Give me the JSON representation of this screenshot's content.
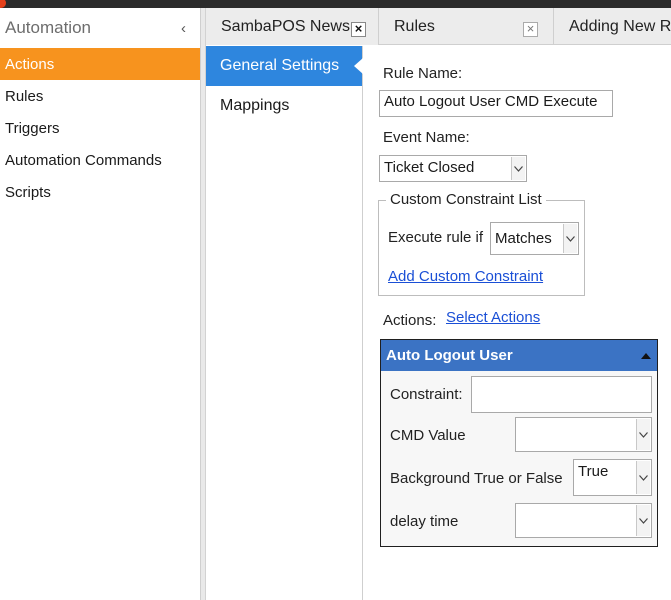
{
  "sidebar": {
    "title": "Automation",
    "items": [
      {
        "label": "Actions",
        "active": true
      },
      {
        "label": "Rules"
      },
      {
        "label": "Triggers"
      },
      {
        "label": "Automation Commands"
      },
      {
        "label": "Scripts"
      }
    ]
  },
  "tabs": [
    {
      "label": "SambaPOS News"
    },
    {
      "label": "Rules"
    },
    {
      "label": "Adding New R"
    }
  ],
  "settings_nav": [
    {
      "label": "General Settings",
      "active": true
    },
    {
      "label": "Mappings"
    }
  ],
  "form": {
    "rule_name_label": "Rule Name:",
    "rule_name_value": "Auto Logout User CMD Execute",
    "event_name_label": "Event Name:",
    "event_name_value": "Ticket Closed",
    "constraint_group_title": "Custom Constraint List",
    "execute_rule_label": "Execute rule if",
    "execute_rule_value": "Matches",
    "add_constraint_link": "Add Custom Constraint",
    "actions_label": "Actions:",
    "select_actions_link": "Select Actions"
  },
  "action": {
    "title": "Auto Logout User",
    "constraint_label": "Constraint:",
    "constraint_value": "",
    "cmd_value_label": "CMD Value",
    "cmd_value": "",
    "background_label": "Background True or False",
    "background_value": "True",
    "delay_label": "delay time",
    "delay_value": ""
  },
  "colors": {
    "sidebar_active": "#f7931e",
    "nav_active": "#2e86de",
    "action_header": "#3b73c4",
    "link": "#1a4fd6"
  }
}
